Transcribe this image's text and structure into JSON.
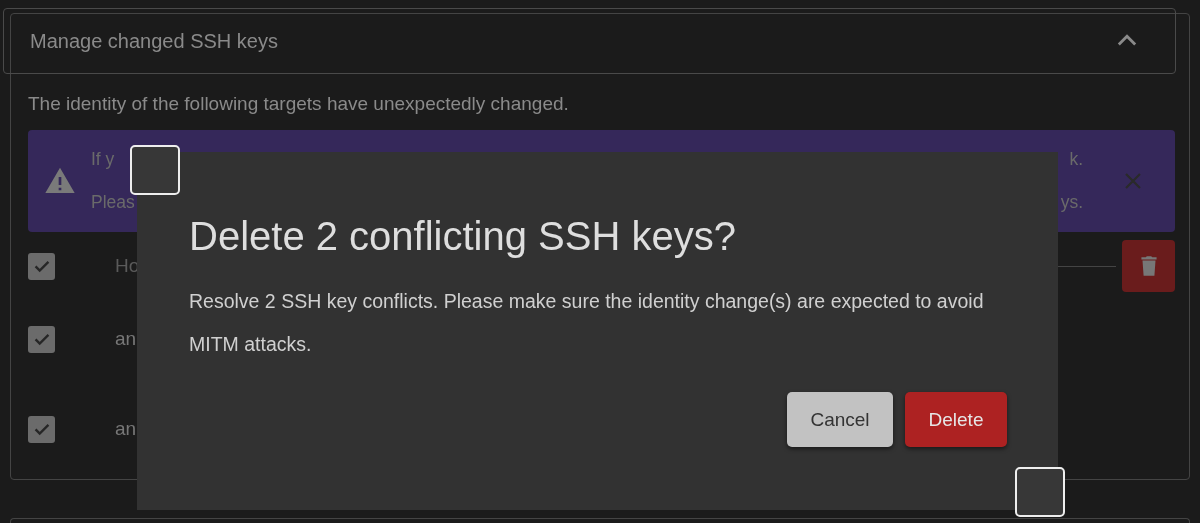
{
  "panel": {
    "title": "Manage changed SSH keys",
    "expanded": true,
    "description": "The identity of the following targets have unexpectedly changed.",
    "alert": {
      "line_1_start": "If y",
      "line_1_end": "k.",
      "line_2_start": "Pleas",
      "line_2_end": "ys."
    },
    "table": {
      "select_all": {
        "checked": true
      },
      "columns": [
        "Ho"
      ],
      "rows": [
        {
          "checked": true,
          "host": "an"
        },
        {
          "checked": true,
          "host": "an"
        }
      ]
    }
  },
  "dialog": {
    "title": "Delete 2 conflicting SSH keys?",
    "body": "Resolve 2 SSH key conflicts. Please make sure the identity change(s) are expected to avoid MITM attacks.",
    "buttons": [
      {
        "label": "Cancel",
        "kind": "secondary"
      },
      {
        "label": "Delete",
        "kind": "danger"
      }
    ]
  }
}
